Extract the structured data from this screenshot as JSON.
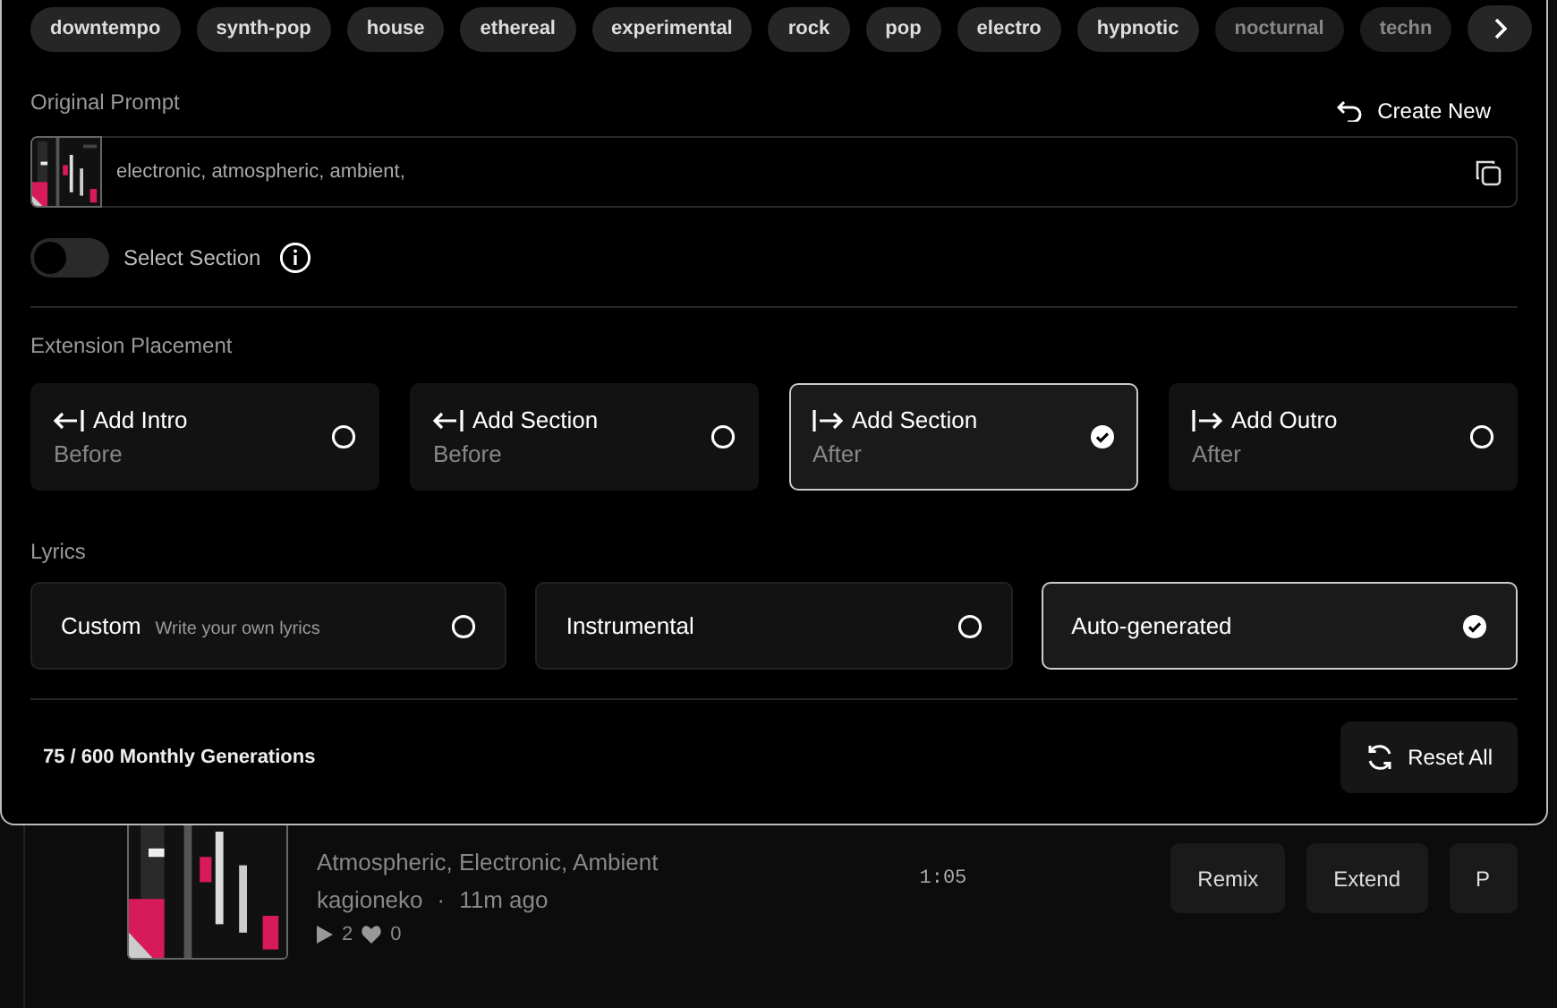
{
  "tags": [
    {
      "label": "downtempo",
      "faded": false
    },
    {
      "label": "synth-pop",
      "faded": false
    },
    {
      "label": "house",
      "faded": false
    },
    {
      "label": "ethereal",
      "faded": false
    },
    {
      "label": "experimental",
      "faded": false
    },
    {
      "label": "rock",
      "faded": false
    },
    {
      "label": "pop",
      "faded": false
    },
    {
      "label": "electro",
      "faded": false
    },
    {
      "label": "hypnotic",
      "faded": false
    },
    {
      "label": "nocturnal",
      "faded": true
    },
    {
      "label": "techn",
      "faded": true
    }
  ],
  "prompt": {
    "label": "Original Prompt",
    "create_new": "Create New",
    "value": "electronic, atmospheric, ambient,"
  },
  "select_section": {
    "label": "Select Section",
    "on": false
  },
  "placement": {
    "label": "Extension Placement",
    "options": [
      {
        "title": "Add Intro",
        "sub": "Before",
        "kind": "before",
        "selected": false
      },
      {
        "title": "Add Section",
        "sub": "Before",
        "kind": "before",
        "selected": false
      },
      {
        "title": "Add Section",
        "sub": "After",
        "kind": "after",
        "selected": true
      },
      {
        "title": "Add Outro",
        "sub": "After",
        "kind": "after",
        "selected": false
      }
    ]
  },
  "lyrics": {
    "label": "Lyrics",
    "options": [
      {
        "title": "Custom",
        "hint": "Write your own lyrics",
        "selected": false
      },
      {
        "title": "Instrumental",
        "selected": false
      },
      {
        "title": "Auto-generated",
        "selected": true
      }
    ]
  },
  "footer": {
    "usage": "75 / 600 Monthly Generations",
    "reset": "Reset All"
  },
  "track": {
    "tags": "Atmospheric, Electronic, Ambient",
    "author": "kagioneko",
    "separator": "·",
    "time": "11m ago",
    "plays": "2",
    "likes": "0",
    "duration": "1:05",
    "actions": [
      "Remix",
      "Extend",
      "P"
    ]
  }
}
